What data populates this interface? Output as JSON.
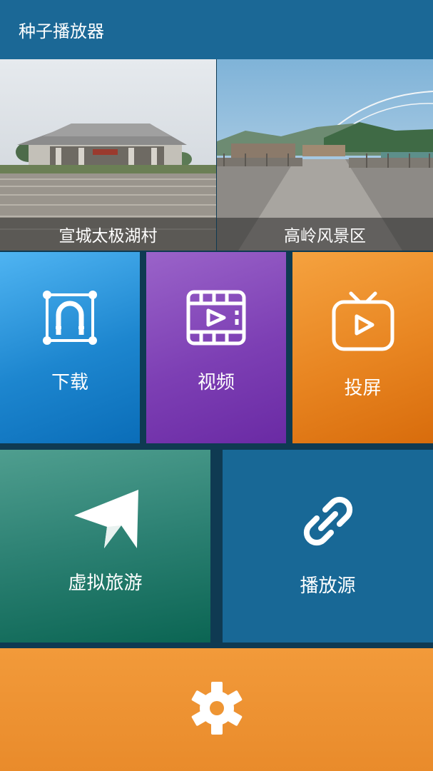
{
  "app": {
    "title": "种子播放器"
  },
  "banners": [
    {
      "caption": "宣城太极湖村"
    },
    {
      "caption": "高岭风景区"
    }
  ],
  "tiles": {
    "download": {
      "label": "下载",
      "icon": "magnet-icon"
    },
    "video": {
      "label": "视频",
      "icon": "film-icon"
    },
    "cast": {
      "label": "投屏",
      "icon": "tv-icon"
    },
    "tour": {
      "label": "虚拟旅游",
      "icon": "paper-plane-icon"
    },
    "source": {
      "label": "播放源",
      "icon": "link-icon"
    },
    "settings": {
      "label": "",
      "icon": "gear-icon"
    }
  },
  "colors": {
    "header": "#1b6896",
    "download": "#1d86cf",
    "video": "#7d3fb4",
    "cast": "#e88521",
    "tour": "#2b8072",
    "source": "#186896",
    "settings": "#f29a3a"
  }
}
